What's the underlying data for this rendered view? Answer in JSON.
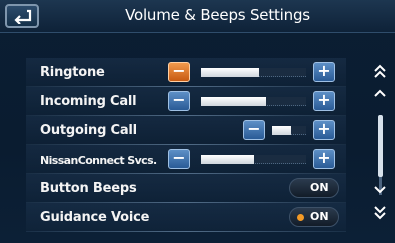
{
  "header": {
    "title": "Volume & Beeps Settings",
    "back_icon": "back-arrow-icon"
  },
  "colors": {
    "accent_orange": "#e8751f",
    "button_blue": "#3a6ea8",
    "toggle_on_dot": "#f39a26",
    "background": "#0b1e33"
  },
  "rows": [
    {
      "label": "Ringtone",
      "type": "slider",
      "level": 0.55,
      "minus_active": true
    },
    {
      "label": "Incoming Call",
      "type": "slider",
      "level": 0.62,
      "minus_active": false
    },
    {
      "label": "Outgoing Call",
      "type": "slider",
      "level": 0.55,
      "minus_active": false
    },
    {
      "label": "NissanConnect Svcs.",
      "type": "slider",
      "level": 0.5,
      "minus_active": false
    },
    {
      "label": "Button Beeps",
      "type": "toggle",
      "value": "ON",
      "dot": false
    },
    {
      "label": "Guidance Voice",
      "type": "toggle",
      "value": "ON",
      "dot": true
    }
  ],
  "scroll": {
    "page_up_icon": "double-chevron-up-icon",
    "up_icon": "chevron-up-icon",
    "down_icon": "chevron-down-icon",
    "page_down_icon": "double-chevron-down-icon"
  }
}
